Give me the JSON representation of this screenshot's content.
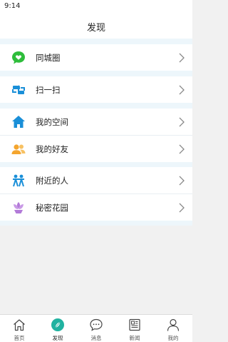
{
  "status_bar": {
    "time": "9:14"
  },
  "header": {
    "title": "发现"
  },
  "menu": [
    {
      "label": "同城圈",
      "icon": "chat-bubble-heart-icon",
      "color": "#2ebd3b"
    },
    {
      "label": "扫一扫",
      "icon": "scan-icon",
      "color": "#1a8fd8"
    },
    {
      "label": "我的空间",
      "icon": "home-icon",
      "color": "#1a8fd8"
    },
    {
      "label": "我的好友",
      "icon": "friends-icon",
      "color": "#f4a52e"
    },
    {
      "label": "附近的人",
      "icon": "nearby-people-icon",
      "color": "#1a8fd8"
    },
    {
      "label": "秘密花园",
      "icon": "flower-icon",
      "color": "#b27ad8"
    }
  ],
  "tabs": [
    {
      "label": "首页",
      "icon": "home-outline-icon",
      "active": false
    },
    {
      "label": "发现",
      "icon": "compass-icon",
      "active": true,
      "color": "#20b2a0"
    },
    {
      "label": "消息",
      "icon": "message-icon",
      "active": false
    },
    {
      "label": "新闻",
      "icon": "news-icon",
      "active": false
    },
    {
      "label": "我的",
      "icon": "profile-icon",
      "active": false
    }
  ]
}
